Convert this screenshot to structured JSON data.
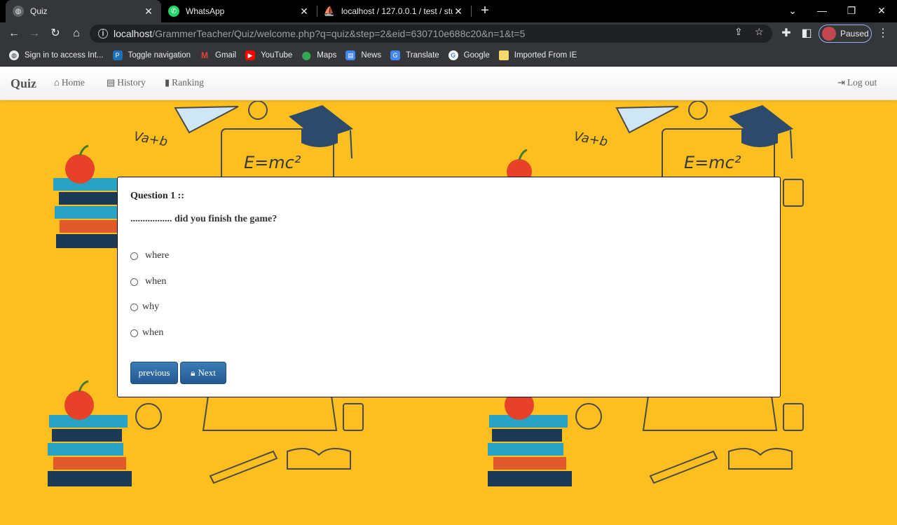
{
  "browser": {
    "tabs": [
      {
        "title": "Quiz",
        "active": true
      },
      {
        "title": "WhatsApp",
        "active": false
      },
      {
        "title": "localhost / 127.0.0.1 / test / stude",
        "active": false
      }
    ],
    "url_host": "localhost",
    "url_path": "/GrammerTeacher/Quiz/welcome.php?q=quiz&step=2&eid=630710e688c20&n=1&t=5",
    "profile_label": "Paused",
    "bookmarks": [
      {
        "label": "Sign in to access Int...",
        "icon": "globe-icon"
      },
      {
        "label": "Toggle navigation",
        "icon": "paypal-icon"
      },
      {
        "label": "Gmail",
        "icon": "gmail-icon"
      },
      {
        "label": "YouTube",
        "icon": "youtube-icon"
      },
      {
        "label": "Maps",
        "icon": "maps-icon"
      },
      {
        "label": "News",
        "icon": "news-icon"
      },
      {
        "label": "Translate",
        "icon": "translate-icon"
      },
      {
        "label": "Google",
        "icon": "google-icon"
      },
      {
        "label": "Imported From IE",
        "icon": "folder-icon"
      }
    ]
  },
  "navbar": {
    "brand": "Quiz",
    "links": [
      {
        "label": "Home",
        "icon": "home-icon"
      },
      {
        "label": "History",
        "icon": "list-icon"
      },
      {
        "label": "Ranking",
        "icon": "bar-chart-icon"
      }
    ],
    "logout": "Log out"
  },
  "quiz": {
    "question_label": "Question  1 ::",
    "question_text": "................. did you finish the game?",
    "options": [
      "where",
      "when",
      "why",
      "when"
    ],
    "previous_label": "previous",
    "next_label": "Next"
  },
  "background": {
    "equation": "E=mc²",
    "formula": "Va+b",
    "color": "#fdbf1f"
  }
}
